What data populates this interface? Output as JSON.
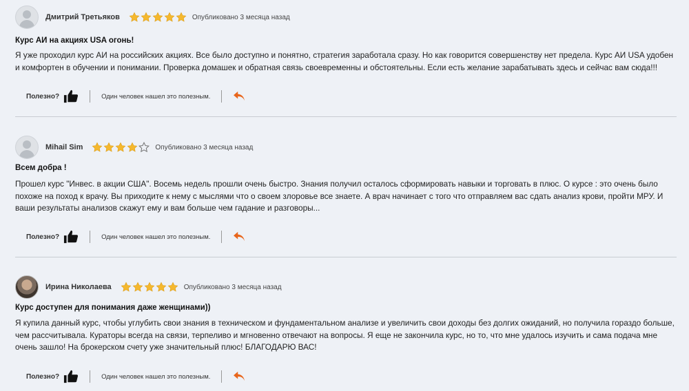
{
  "reviews": [
    {
      "author": "Дмитрий Третьяков",
      "rating": 5,
      "published": "Опубликовано 3 месяца назад",
      "title": "Курс АИ на акциях USA огонь!",
      "text": "Я уже проходил курс АИ на российских акциях. Все было доступно и понятно, стратегия заработала сразу. Но как говорится совершенству нет предела. Курс АИ USA удобен и комфортен в обучении и понимании. Проверка домашек и обратная связь своевременны и обстоятельны. Если есть желание зарабатывать здесь и сейчас вам сюда!!!",
      "helpful_label": "Полезно?",
      "found_helpful": "Один человек нашел это полезным."
    },
    {
      "author": "Mihail Sim",
      "rating": 4,
      "published": "Опубликовано 3 месяца назад",
      "title": "Всем добра !",
      "text": "Прошел курс \"Инвес. в акции США\". Восемь недель прошли очень быстро. Знания получил осталось сформировать навыки и торговать в плюс. О курсе : это очень было похоже на поход к врачу. Вы приходите к нему с мыслями что о своем злоровье все знаете. А врач начинает с того что отправляем вас сдать анализ крови, пройти МРУ. И ваши результаты анализов скажут ему и вам больше чем гадание и разговоры...",
      "helpful_label": "Полезно?",
      "found_helpful": "Один человек нашел это полезным."
    },
    {
      "author": "Ирина Николаева",
      "rating": 5,
      "published": "Опубликовано 3 месяца назад",
      "title": "Курс доступен для понимания даже женщинами))",
      "text": "Я купила данный курс, чтобы углубить свои знания в техническом и фундаментальном анализе и увеличить свои доходы без долгих ожиданий, но получила гораздо больше, чем рассчитывала. Кураторы всегда на связи, терпеливо и мгновенно отвечают на вопросы. Я еще не закончила курс, но то, что мне удалось изучить и сама подача мне очень зашло! На брокерском счету уже значительный плюс! БЛАГОДАРЮ ВАС!",
      "helpful_label": "Полезно?",
      "found_helpful": "Один человек нашел это полезным."
    }
  ],
  "icons": {
    "star": "star-icon",
    "thumb": "thumbs-up-icon",
    "reply": "reply-arrow-icon"
  },
  "colors": {
    "star_filled": "#f5b82e",
    "star_empty_stroke": "#777777",
    "reply": "#e8661c",
    "thumb": "#111111"
  }
}
